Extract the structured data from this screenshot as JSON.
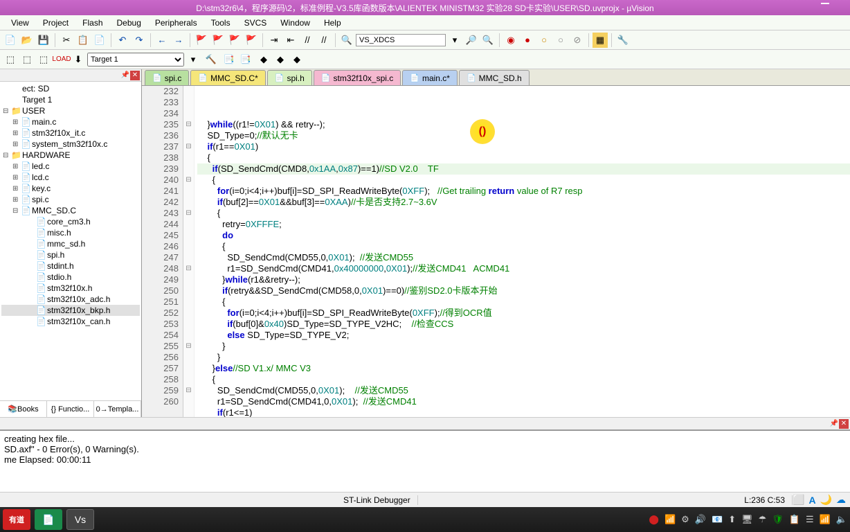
{
  "title": "D:\\stm32r6\\4，程序源码\\2，标准例程-V3.5库函数版本\\ALIENTEK MINISTM32 实验28 SD卡实验\\USER\\SD.uvprojx - µVision",
  "menu": [
    "View",
    "Project",
    "Flash",
    "Debug",
    "Peripherals",
    "Tools",
    "SVCS",
    "Window",
    "Help"
  ],
  "toolbarSearch": "VS_XDCS",
  "target": "Target 1",
  "tree": {
    "root": "ect: SD",
    "target": "Target 1",
    "groups": [
      {
        "name": "USER",
        "icon": "📁",
        "files": [
          "main.c",
          "stm32f10x_it.c",
          "system_stm32f10x.c"
        ]
      },
      {
        "name": "HARDWARE",
        "icon": "📁",
        "files": [
          "led.c",
          "lcd.c",
          "key.c",
          "spi.c",
          {
            "name": "MMC_SD.C",
            "children": [
              "core_cm3.h",
              "misc.h",
              "mmc_sd.h",
              "spi.h",
              "stdint.h",
              "stdio.h",
              "stm32f10x.h",
              "stm32f10x_adc.h",
              "stm32f10x_bkp.h",
              "stm32f10x_can.h"
            ]
          }
        ]
      }
    ]
  },
  "sidebarTabs": [
    "📚Books",
    "{} Functio...",
    "0→Templa..."
  ],
  "fileTabs": [
    {
      "label": "spi.c",
      "cls": "tab-green"
    },
    {
      "label": "MMC_SD.C*",
      "cls": "tab-yellow"
    },
    {
      "label": "spi.h",
      "cls": "tab-lgreen"
    },
    {
      "label": "stm32f10x_spi.c",
      "cls": "tab-pink"
    },
    {
      "label": "main.c*",
      "cls": "tab-blue"
    },
    {
      "label": "MMC_SD.h",
      "cls": "tab-gray"
    }
  ],
  "code": {
    "start": 232,
    "lines": [
      "    }while((r1!=0X01) && retry--);",
      "    SD_Type=0;//默认无卡",
      "    if(r1==0X01)",
      "    {",
      "      if(SD_SendCmd(CMD8,0x1AA,0x87)==1)//SD V2.0    TF",
      "      {",
      "        for(i=0;i<4;i++)buf[i]=SD_SPI_ReadWriteByte(0XFF);   //Get trailing return value of R7 resp",
      "        if(buf[2]==0X01&&buf[3]==0XAA)//卡是否支持2.7~3.6V",
      "        {",
      "          retry=0XFFFE;",
      "          do",
      "          {",
      "            SD_SendCmd(CMD55,0,0X01);  //发送CMD55",
      "            r1=SD_SendCmd(CMD41,0x40000000,0X01);//发送CMD41   ACMD41",
      "          }while(r1&&retry--);",
      "          if(retry&&SD_SendCmd(CMD58,0,0X01)==0)//鉴别SD2.0卡版本开始",
      "          {",
      "            for(i=0;i<4;i++)buf[i]=SD_SPI_ReadWriteByte(0XFF);//得到OCR值",
      "            if(buf[0]&0x40)SD_Type=SD_TYPE_V2HC;    //检查CCS",
      "            else SD_Type=SD_TYPE_V2;",
      "          }",
      "        }",
      "      }else//SD V1.x/ MMC V3",
      "      {",
      "        SD_SendCmd(CMD55,0,0X01);    //发送CMD55",
      "        r1=SD_SendCmd(CMD41,0,0X01);  //发送CMD41",
      "        if(r1<=1)",
      "        {",
      ""
    ],
    "currentLine": 236
  },
  "buildOutput": [
    "creating hex file...",
    "SD.axf\" - 0 Error(s), 0 Warning(s).",
    "me Elapsed:  00:00:11"
  ],
  "status": {
    "debugger": "ST-Link Debugger",
    "pos": "L:236 C:53"
  },
  "taskbar": {
    "youdao": "有道",
    "pdf": "PDF",
    "vs": "Vs"
  }
}
